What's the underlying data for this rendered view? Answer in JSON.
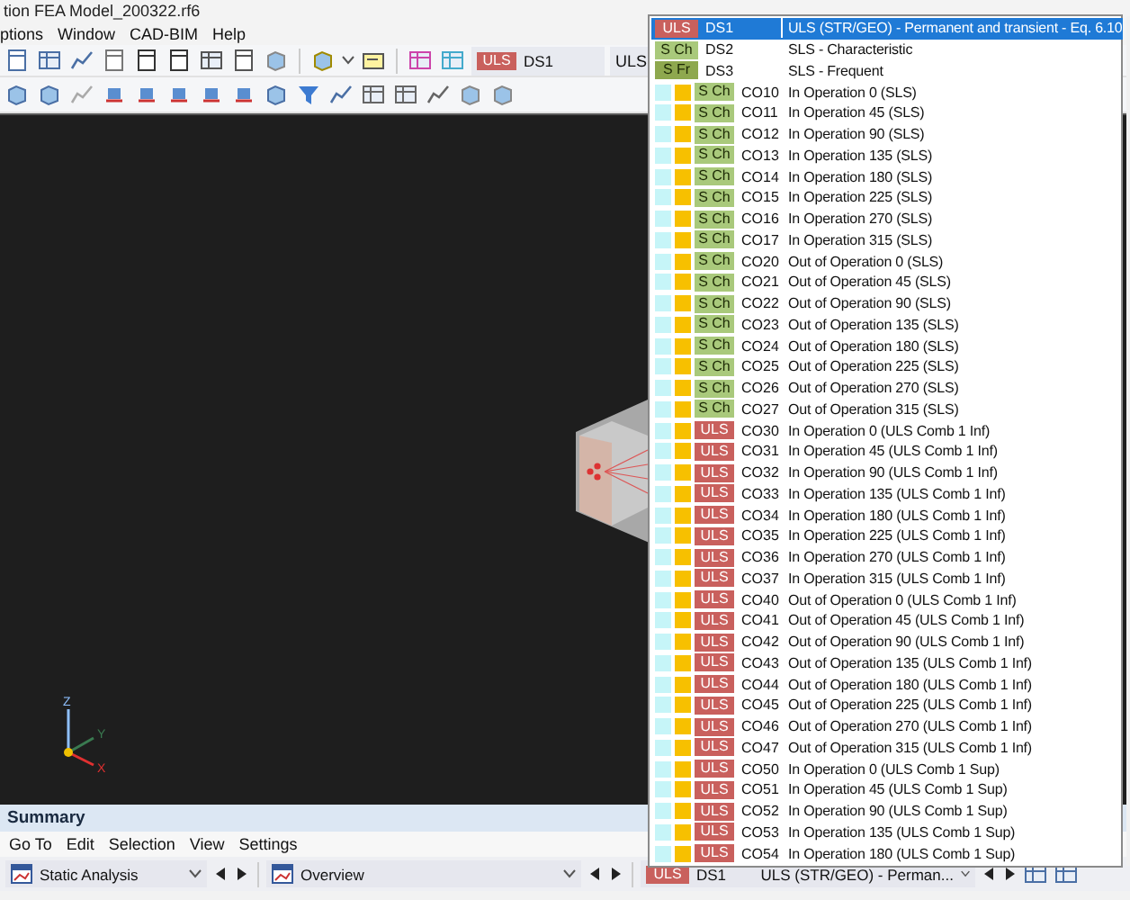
{
  "window": {
    "title": "tion FEA Model_200322.rf6"
  },
  "menu": [
    "ptions",
    "Window",
    "CAD-BIM",
    "Help"
  ],
  "toolbar": {
    "situation_combo": {
      "badge": "ULS",
      "color": "#c9605d",
      "code": "DS1"
    },
    "next_combo": "ULS"
  },
  "viewport": {
    "axes": [
      "Z",
      "Y",
      "X"
    ]
  },
  "dropdown": {
    "items": [
      {
        "kind": "situation",
        "badge": "ULS",
        "color": "#c9605d",
        "code": "DS1",
        "description": "ULS (STR/GEO) - Permanent and transient - Eq. 6.10",
        "selected": true
      },
      {
        "kind": "situation",
        "badge": "S Ch",
        "color": "#a9c97b",
        "code": "DS2",
        "description": "SLS - Characteristic",
        "selected": false
      },
      {
        "kind": "situation",
        "badge": "S Fr",
        "color": "#8ea84e",
        "code": "DS3",
        "description": "SLS - Frequent",
        "selected": false
      },
      {
        "kind": "combination",
        "badge": "S Ch",
        "color": "#a9c97b",
        "code": "CO10",
        "description": "In Operation 0 (SLS)",
        "selected": false
      },
      {
        "kind": "combination",
        "badge": "S Ch",
        "color": "#a9c97b",
        "code": "CO11",
        "description": "In Operation 45 (SLS)",
        "selected": false
      },
      {
        "kind": "combination",
        "badge": "S Ch",
        "color": "#a9c97b",
        "code": "CO12",
        "description": "In Operation 90 (SLS)",
        "selected": false
      },
      {
        "kind": "combination",
        "badge": "S Ch",
        "color": "#a9c97b",
        "code": "CO13",
        "description": "In Operation 135 (SLS)",
        "selected": false
      },
      {
        "kind": "combination",
        "badge": "S Ch",
        "color": "#a9c97b",
        "code": "CO14",
        "description": "In Operation 180 (SLS)",
        "selected": false
      },
      {
        "kind": "combination",
        "badge": "S Ch",
        "color": "#a9c97b",
        "code": "CO15",
        "description": "In Operation 225 (SLS)",
        "selected": false
      },
      {
        "kind": "combination",
        "badge": "S Ch",
        "color": "#a9c97b",
        "code": "CO16",
        "description": "In Operation 270 (SLS)",
        "selected": false
      },
      {
        "kind": "combination",
        "badge": "S Ch",
        "color": "#a9c97b",
        "code": "CO17",
        "description": "In Operation 315 (SLS)",
        "selected": false
      },
      {
        "kind": "combination",
        "badge": "S Ch",
        "color": "#a9c97b",
        "code": "CO20",
        "description": "Out of Operation 0 (SLS)",
        "selected": false
      },
      {
        "kind": "combination",
        "badge": "S Ch",
        "color": "#a9c97b",
        "code": "CO21",
        "description": "Out of Operation 45 (SLS)",
        "selected": false
      },
      {
        "kind": "combination",
        "badge": "S Ch",
        "color": "#a9c97b",
        "code": "CO22",
        "description": "Out of Operation 90 (SLS)",
        "selected": false
      },
      {
        "kind": "combination",
        "badge": "S Ch",
        "color": "#a9c97b",
        "code": "CO23",
        "description": "Out of Operation 135 (SLS)",
        "selected": false
      },
      {
        "kind": "combination",
        "badge": "S Ch",
        "color": "#a9c97b",
        "code": "CO24",
        "description": "Out of Operation 180 (SLS)",
        "selected": false
      },
      {
        "kind": "combination",
        "badge": "S Ch",
        "color": "#a9c97b",
        "code": "CO25",
        "description": "Out of Operation 225 (SLS)",
        "selected": false
      },
      {
        "kind": "combination",
        "badge": "S Ch",
        "color": "#a9c97b",
        "code": "CO26",
        "description": "Out of Operation 270 (SLS)",
        "selected": false
      },
      {
        "kind": "combination",
        "badge": "S Ch",
        "color": "#a9c97b",
        "code": "CO27",
        "description": "Out of Operation 315 (SLS)",
        "selected": false
      },
      {
        "kind": "combination",
        "badge": "ULS",
        "color": "#c9605d",
        "code": "CO30",
        "description": "In Operation 0 (ULS Comb 1 Inf)",
        "selected": false
      },
      {
        "kind": "combination",
        "badge": "ULS",
        "color": "#c9605d",
        "code": "CO31",
        "description": "In Operation 45 (ULS Comb 1 Inf)",
        "selected": false
      },
      {
        "kind": "combination",
        "badge": "ULS",
        "color": "#c9605d",
        "code": "CO32",
        "description": "In Operation 90 (ULS Comb 1 Inf)",
        "selected": false
      },
      {
        "kind": "combination",
        "badge": "ULS",
        "color": "#c9605d",
        "code": "CO33",
        "description": "In Operation 135 (ULS Comb 1 Inf)",
        "selected": false
      },
      {
        "kind": "combination",
        "badge": "ULS",
        "color": "#c9605d",
        "code": "CO34",
        "description": "In Operation 180 (ULS Comb 1 Inf)",
        "selected": false
      },
      {
        "kind": "combination",
        "badge": "ULS",
        "color": "#c9605d",
        "code": "CO35",
        "description": "In Operation 225 (ULS Comb 1 Inf)",
        "selected": false
      },
      {
        "kind": "combination",
        "badge": "ULS",
        "color": "#c9605d",
        "code": "CO36",
        "description": "In Operation 270 (ULS Comb 1 Inf)",
        "selected": false
      },
      {
        "kind": "combination",
        "badge": "ULS",
        "color": "#c9605d",
        "code": "CO37",
        "description": "In Operation 315 (ULS Comb 1 Inf)",
        "selected": false
      },
      {
        "kind": "combination",
        "badge": "ULS",
        "color": "#c9605d",
        "code": "CO40",
        "description": "Out of Operation 0 (ULS Comb 1 Inf)",
        "selected": false
      },
      {
        "kind": "combination",
        "badge": "ULS",
        "color": "#c9605d",
        "code": "CO41",
        "description": "Out of Operation 45 (ULS Comb 1 Inf)",
        "selected": false
      },
      {
        "kind": "combination",
        "badge": "ULS",
        "color": "#c9605d",
        "code": "CO42",
        "description": "Out of Operation 90 (ULS Comb 1 Inf)",
        "selected": false
      },
      {
        "kind": "combination",
        "badge": "ULS",
        "color": "#c9605d",
        "code": "CO43",
        "description": "Out of Operation 135 (ULS Comb 1 Inf)",
        "selected": false
      },
      {
        "kind": "combination",
        "badge": "ULS",
        "color": "#c9605d",
        "code": "CO44",
        "description": "Out of Operation 180 (ULS Comb 1 Inf)",
        "selected": false
      },
      {
        "kind": "combination",
        "badge": "ULS",
        "color": "#c9605d",
        "code": "CO45",
        "description": "Out of Operation 225 (ULS Comb 1 Inf)",
        "selected": false
      },
      {
        "kind": "combination",
        "badge": "ULS",
        "color": "#c9605d",
        "code": "CO46",
        "description": "Out of Operation 270 (ULS Comb 1 Inf)",
        "selected": false
      },
      {
        "kind": "combination",
        "badge": "ULS",
        "color": "#c9605d",
        "code": "CO47",
        "description": "Out of Operation 315 (ULS Comb 1 Inf)",
        "selected": false
      },
      {
        "kind": "combination",
        "badge": "ULS",
        "color": "#c9605d",
        "code": "CO50",
        "description": "In Operation 0 (ULS Comb 1 Sup)",
        "selected": false
      },
      {
        "kind": "combination",
        "badge": "ULS",
        "color": "#c9605d",
        "code": "CO51",
        "description": "In Operation 45 (ULS Comb 1 Sup)",
        "selected": false
      },
      {
        "kind": "combination",
        "badge": "ULS",
        "color": "#c9605d",
        "code": "CO52",
        "description": "In Operation 90 (ULS Comb 1 Sup)",
        "selected": false
      },
      {
        "kind": "combination",
        "badge": "ULS",
        "color": "#c9605d",
        "code": "CO53",
        "description": "In Operation 135 (ULS Comb 1 Sup)",
        "selected": false
      },
      {
        "kind": "combination",
        "badge": "ULS",
        "color": "#c9605d",
        "code": "CO54",
        "description": "In Operation 180 (ULS Comb 1 Sup)",
        "selected": false
      }
    ]
  },
  "summary": {
    "title": "Summary",
    "menu": [
      "Go To",
      "Edit",
      "Selection",
      "View",
      "Settings"
    ],
    "combos": [
      {
        "value": "Static Analysis"
      },
      {
        "value": "Overview"
      }
    ],
    "situation_combo": {
      "badge": "ULS",
      "color": "#c9605d",
      "code": "DS1",
      "value": "ULS (STR/GEO) - Perman..."
    }
  }
}
